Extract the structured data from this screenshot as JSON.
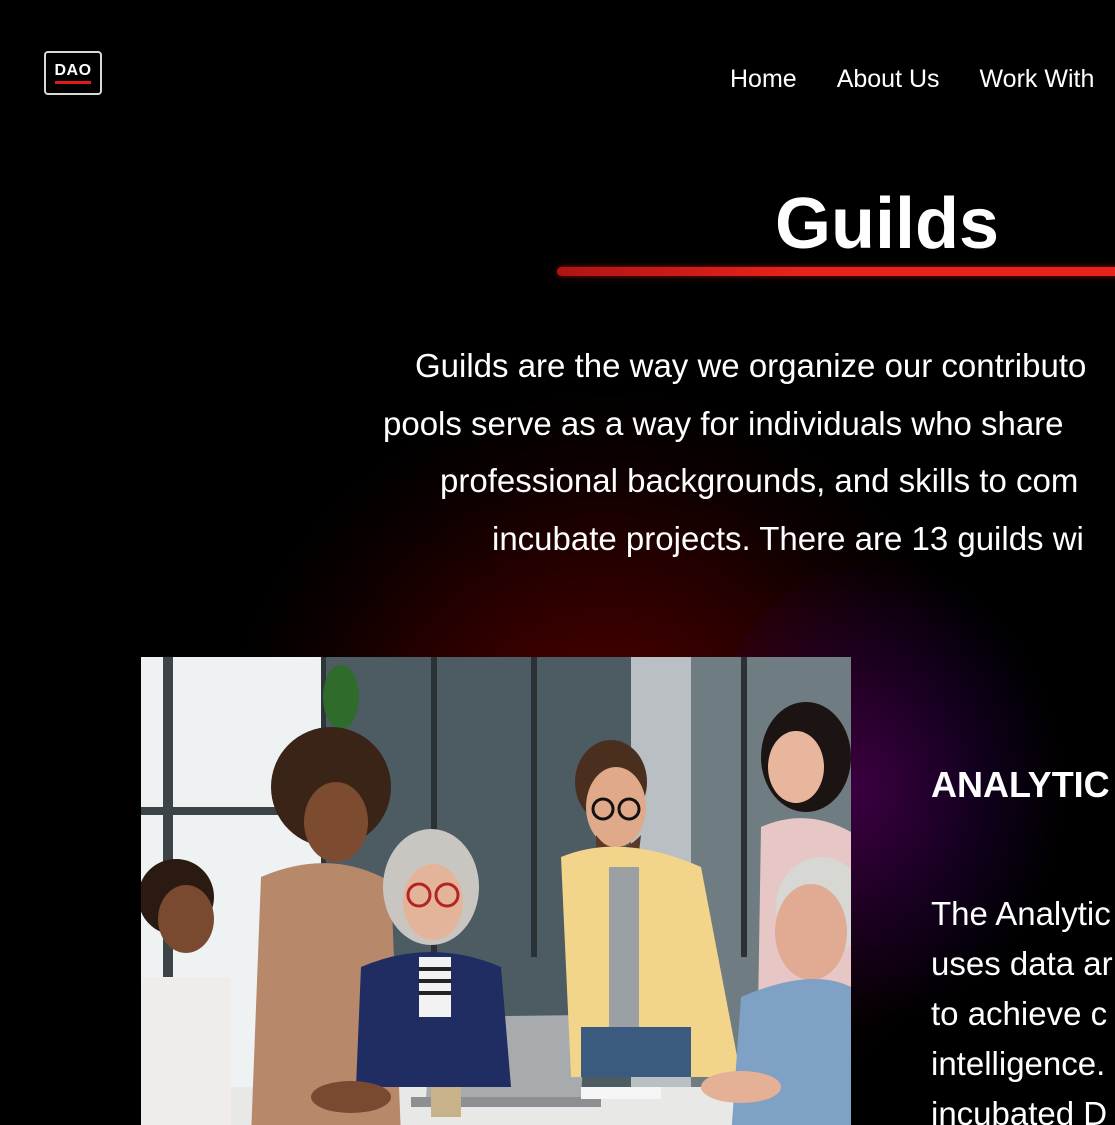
{
  "logo": {
    "text": "DAO"
  },
  "nav": {
    "items": [
      "Home",
      "About Us",
      "Work With"
    ]
  },
  "hero": {
    "title": "Guilds",
    "intro_lines": [
      "Guilds are the way we organize our contributo",
      "pools serve as a way for individuals who share",
      "professional backgrounds, and skills to com",
      "incubate projects. There are 13 guilds wi"
    ]
  },
  "guild": {
    "heading": "ANALYTIC",
    "description_lines": [
      "The Analytic",
      "uses data ar",
      "to achieve c",
      "intelligence.",
      "incubated D"
    ]
  },
  "colors": {
    "background": "#000000",
    "accent_red": "#e8231c",
    "text": "#ffffff"
  }
}
